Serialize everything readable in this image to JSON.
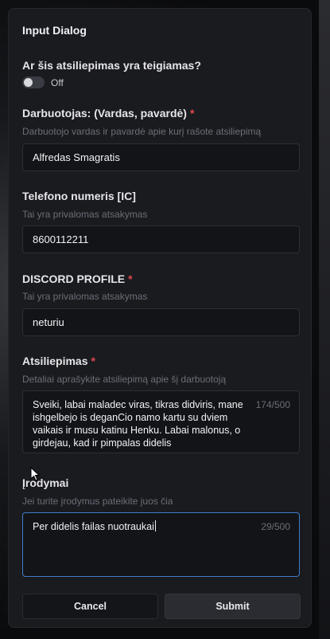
{
  "dialog": {
    "title": "Input Dialog",
    "positive": {
      "label": "Ar šis atsiliepimas yra teigiamas?",
      "state": "Off",
      "checked": false
    },
    "employee": {
      "label": "Darbuotojas: (Vardas, pavardė)",
      "required": "*",
      "description": "Darbuotojo vardas ir pavardė apie kurį rašote atsiliepimą",
      "value": "Alfredas Smagratis"
    },
    "phone": {
      "label": "Telefono numeris [IC]",
      "description": "Tai yra privalomas atsakymas",
      "value": "8600112211"
    },
    "discord": {
      "label": "DISCORD PROFILE",
      "required": "*",
      "description": "Tai yra privalomas atsakymas",
      "value": "neturiu"
    },
    "review": {
      "label": "Atsiliepimas",
      "required": "*",
      "description": "Detaliai aprašykite atsiliepimą apie šį darbuotoją",
      "value": "Sveiki, labai maladec viras, tikras didviris, mane ishgelbejo is deganCio namo kartu su dviem vaikais ir musu katinu Henku. Labai malonus, o girdejau, kad ir pimpalas didelis",
      "counter": "174/500"
    },
    "evidence": {
      "label": "Įrodymai",
      "description": "Jei turite įrodymus pateikite juos čia",
      "value": "Per didelis failas nuotraukai",
      "counter": "29/500"
    },
    "buttons": {
      "cancel": "Cancel",
      "submit": "Submit"
    }
  },
  "colors": {
    "dialog_bg": "#1a1b1f",
    "required": "#e0484e",
    "focus": "#3d7fc9"
  }
}
